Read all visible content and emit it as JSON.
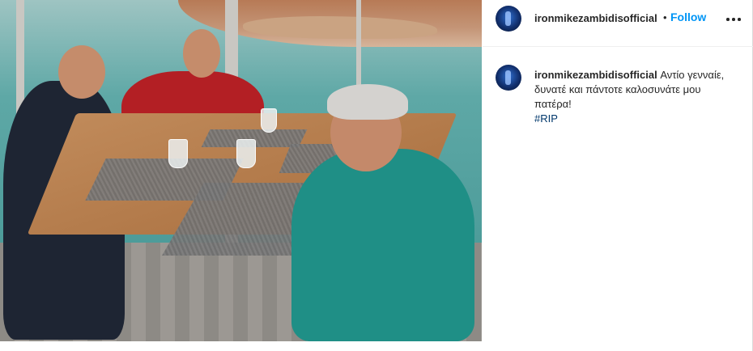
{
  "post": {
    "username": "ironmikezambidisofficial",
    "follow_separator": "•",
    "follow_label": "Follow",
    "more_icon": "more-horizontal-icon",
    "caption": {
      "username": "ironmikezambidisofficial",
      "text": "Αντίο γενναίε, δυνατέ και πάντοτε καλοσυνάτε μου πατέρα!",
      "hashtag": "#RIP"
    }
  },
  "colors": {
    "follow_blue": "#0095f6",
    "hashtag_blue": "#00376b",
    "text": "#262626"
  }
}
